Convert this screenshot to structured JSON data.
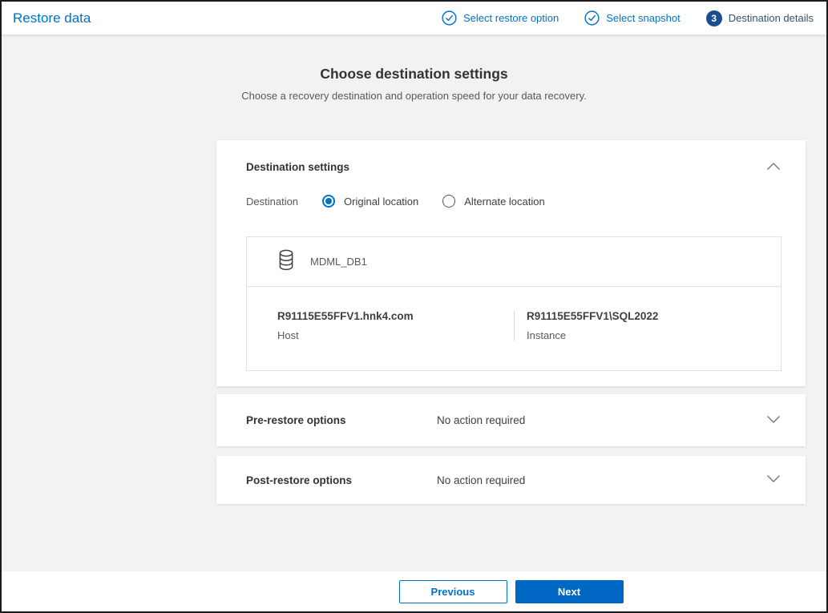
{
  "header": {
    "title": "Restore data",
    "steps": [
      {
        "label": "Select restore option",
        "state": "complete"
      },
      {
        "label": "Select snapshot",
        "state": "complete"
      },
      {
        "label": "Destination details",
        "state": "current",
        "number": "3"
      }
    ]
  },
  "page": {
    "heading": "Choose destination settings",
    "subheading": "Choose a recovery destination and operation speed for your data recovery."
  },
  "destination_settings": {
    "title": "Destination settings",
    "destination_label": "Destination",
    "options": [
      {
        "label": "Original location",
        "selected": true
      },
      {
        "label": "Alternate location",
        "selected": false
      }
    ],
    "database": {
      "name": "MDML_DB1",
      "icon": "database-icon"
    },
    "host": {
      "value": "R91115E55FFV1.hnk4.com",
      "label": "Host"
    },
    "instance": {
      "value": "R91115E55FFV1\\SQL2022",
      "label": "Instance"
    }
  },
  "pre_restore": {
    "title": "Pre-restore options",
    "status": "No action required"
  },
  "post_restore": {
    "title": "Post-restore options",
    "status": "No action required"
  },
  "footer": {
    "previous_label": "Previous",
    "next_label": "Next"
  },
  "colors": {
    "accent_blue": "#0072c6",
    "primary_button_blue": "#0067c5",
    "current_step_circle": "#1a4f8f",
    "current_step_text": "#33536e",
    "page_background": "#f2f2f2",
    "card_background": "#ffffff"
  }
}
